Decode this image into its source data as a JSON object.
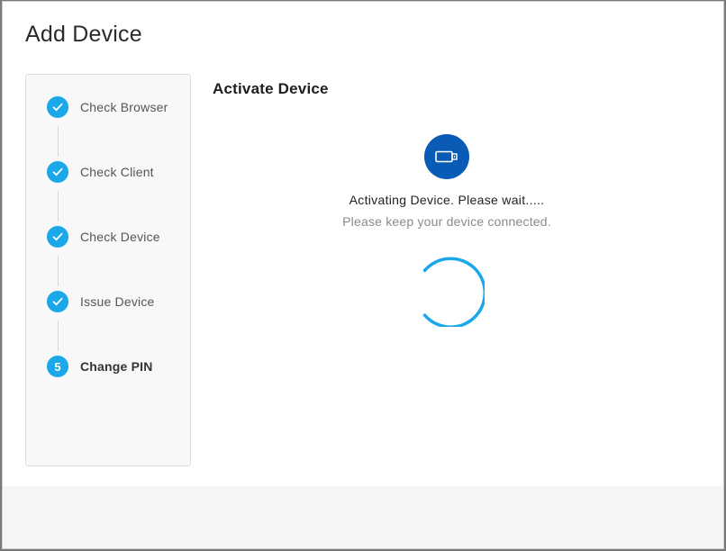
{
  "dialog": {
    "title": "Add Device"
  },
  "stepper": {
    "steps": [
      {
        "label": "Check Browser",
        "state": "done",
        "marker": "check-icon"
      },
      {
        "label": "Check Client",
        "state": "done",
        "marker": "check-icon"
      },
      {
        "label": "Check Device",
        "state": "done",
        "marker": "check-icon"
      },
      {
        "label": "Issue Device",
        "state": "done",
        "marker": "check-icon"
      },
      {
        "label": "Change PIN",
        "state": "active",
        "number": "5"
      }
    ]
  },
  "content": {
    "title": "Activate Device",
    "status": "Activating Device. Please wait.....",
    "sub_status": "Please keep your device connected.",
    "icon": "usb-device-icon",
    "spinner": "loading-spinner"
  },
  "colors": {
    "accent": "#1ba8e8",
    "device_icon_bg": "#0a5bb5"
  }
}
